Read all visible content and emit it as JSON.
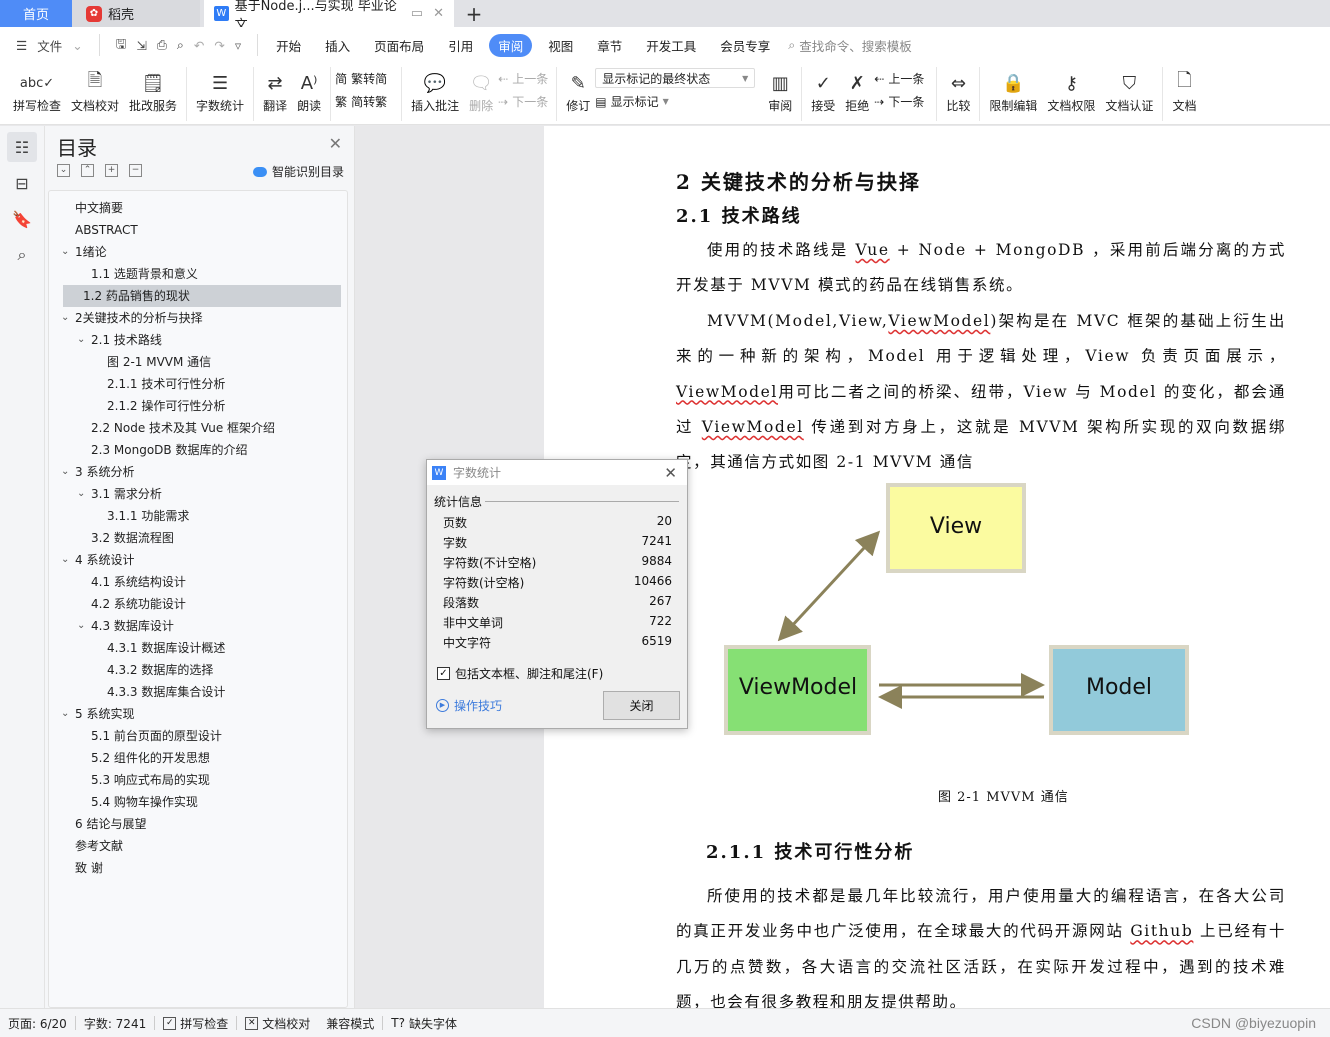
{
  "tabs": {
    "home": "首页",
    "daoke": "稻壳",
    "document": "基于Node.j...与实现 毕业论文",
    "add": "+"
  },
  "menu": {
    "file": "文件",
    "items": [
      "开始",
      "插入",
      "页面布局",
      "引用",
      "审阅",
      "视图",
      "章节",
      "开发工具",
      "会员专享"
    ],
    "active": "审阅",
    "search_placeholder": "查找命令、搜索模板"
  },
  "ribbon": {
    "spell_check": "拼写检查",
    "doc_proof": "文档校对",
    "correction_service": "批改服务",
    "word_count": "字数统计",
    "translate": "翻译",
    "read_aloud": "朗读",
    "trad_to_simp": "繁转简",
    "simp_to_trad": "简转繁",
    "insert_comment": "插入批注",
    "delete": "删除",
    "prev_comment": "上一条",
    "next_comment": "下一条",
    "revise": "修订",
    "markup_state": "显示标记的最终状态",
    "show_markup": "显示标记",
    "review": "审阅",
    "accept": "接受",
    "reject": "拒绝",
    "prev_change": "上一条",
    "next_change": "下一条",
    "compare": "比较",
    "restrict_edit": "限制编辑",
    "doc_permission": "文档权限",
    "doc_certify": "文档认证",
    "doc_more": "文档"
  },
  "toc": {
    "title": "目录",
    "smart_detect": "智能识别目录",
    "items": [
      {
        "label": "中文摘要",
        "level": 0,
        "toggle": false
      },
      {
        "label": "ABSTRACT",
        "level": 0,
        "toggle": false
      },
      {
        "label": "1绪论",
        "level": 0,
        "toggle": true
      },
      {
        "label": "1.1  选题背景和意义",
        "level": 1,
        "toggle": false
      },
      {
        "label": "1.2  药品销售的现状",
        "level": 1,
        "toggle": false,
        "selected": true
      },
      {
        "label": "2关键技术的分析与抉择",
        "level": 0,
        "toggle": true
      },
      {
        "label": "2.1  技术路线",
        "level": 1,
        "toggle": true
      },
      {
        "label": "图 2-1 MVVM 通信",
        "level": 2,
        "toggle": false
      },
      {
        "label": "2.1.1  技术可行性分析",
        "level": 2,
        "toggle": false
      },
      {
        "label": "2.1.2  操作可行性分析",
        "level": 2,
        "toggle": false
      },
      {
        "label": "2.2 Node 技术及其 Vue 框架介绍",
        "level": 1,
        "toggle": false
      },
      {
        "label": "2.3 MongoDB  数据库的介绍",
        "level": 1,
        "toggle": false
      },
      {
        "label": "3  系统分析",
        "level": 0,
        "toggle": true
      },
      {
        "label": "3.1  需求分析",
        "level": 1,
        "toggle": true
      },
      {
        "label": "3.1.1  功能需求",
        "level": 2,
        "toggle": false
      },
      {
        "label": "3.2  数据流程图",
        "level": 1,
        "toggle": false
      },
      {
        "label": "4  系统设计",
        "level": 0,
        "toggle": true
      },
      {
        "label": "4.1  系统结构设计",
        "level": 1,
        "toggle": false
      },
      {
        "label": "4.2  系统功能设计",
        "level": 1,
        "toggle": false
      },
      {
        "label": "4.3  数据库设计",
        "level": 1,
        "toggle": true
      },
      {
        "label": "4.3.1  数据库设计概述",
        "level": 2,
        "toggle": false
      },
      {
        "label": "4.3.2  数据库的选择",
        "level": 2,
        "toggle": false
      },
      {
        "label": "4.3.3  数据库集合设计",
        "level": 2,
        "toggle": false
      },
      {
        "label": "5  系统实现",
        "level": 0,
        "toggle": true
      },
      {
        "label": "5.1  前台页面的原型设计",
        "level": 1,
        "toggle": false
      },
      {
        "label": "5.2  组件化的开发思想",
        "level": 1,
        "toggle": false
      },
      {
        "label": "5.3  响应式布局的实现",
        "level": 1,
        "toggle": false
      },
      {
        "label": "5.4  购物车操作实现",
        "level": 1,
        "toggle": false
      },
      {
        "label": "6  结论与展望",
        "level": 0,
        "toggle": false
      },
      {
        "label": "参考文献",
        "level": 0,
        "toggle": false
      },
      {
        "label": "致  谢",
        "level": 0,
        "toggle": false
      }
    ]
  },
  "document": {
    "h1": "2  关键技术的分析与抉择",
    "h2": "2.1  技术路线",
    "p1_pre": "使用的技术路线是 ",
    "p1_vue": "Vue",
    "p1_post": " + Node + MongoDB ，采用前后端分离的方式开发基于 MVVM 模式的药品在线销售系统。",
    "p2_a": "MVVM(Model,View,",
    "p2_vm1": "ViewModel",
    "p2_b": ")架构是在 MVC 框架的基础上衍生出来的一种新的架构，Model 用于逻辑处理，View 负责页面展示，",
    "p2_vm2": "ViewModel",
    "p2_c": "用可比二者之间的桥梁、纽带，View 与 Model 的变化，都会通过 ",
    "p2_vm3": "ViewModel",
    "p2_d": " 传递到对方身上，这就是 MVVM 架构所实现的双向数据绑定，其通信方式如图 2-1 MVVM 通信",
    "figure": {
      "view": "View",
      "viewmodel": "ViewModel",
      "model": "Model",
      "colors": {
        "view": "#fbfba0",
        "viewmodel": "#86e074",
        "model": "#92cada",
        "border": "#d9d6c4",
        "arrow": "#8b825a"
      }
    },
    "caption": "图 2-1  MVVM 通信",
    "h3": "2.1.1  技术可行性分析",
    "p3_a": "所使用的技术都是最几年比较流行，用户使用量大的编程语言，在各大公司的真正开发业务中也广泛使用，在全球最大的代码开源网站 ",
    "p3_github": "Github",
    "p3_b": " 上已经有十几万的点赞数，各大语言的交流社区活跃，在实际开发过程中，遇到的技术难题，也会有很多教程和朋友提供帮助。"
  },
  "dialog": {
    "title": "字数统计",
    "section": "统计信息",
    "rows": [
      {
        "label": "页数",
        "value": "20"
      },
      {
        "label": "字数",
        "value": "7241"
      },
      {
        "label": "字符数(不计空格)",
        "value": "9884"
      },
      {
        "label": "字符数(计空格)",
        "value": "10466"
      },
      {
        "label": "段落数",
        "value": "267"
      },
      {
        "label": "非中文单词",
        "value": "722"
      },
      {
        "label": "中文字符",
        "value": "6519"
      }
    ],
    "include_label": "包括文本框、脚注和尾注(F)",
    "include_checked": true,
    "tips": "操作技巧",
    "close": "关闭"
  },
  "status": {
    "page": "页面: 6/20",
    "words": "字数: 7241",
    "spell": "拼写检查",
    "proof": "文档校对",
    "compat": "兼容模式",
    "missing_font": "缺失字体",
    "watermark": "CSDN @biyezuopin"
  },
  "colors": {
    "accent": "#4f8cf7"
  }
}
